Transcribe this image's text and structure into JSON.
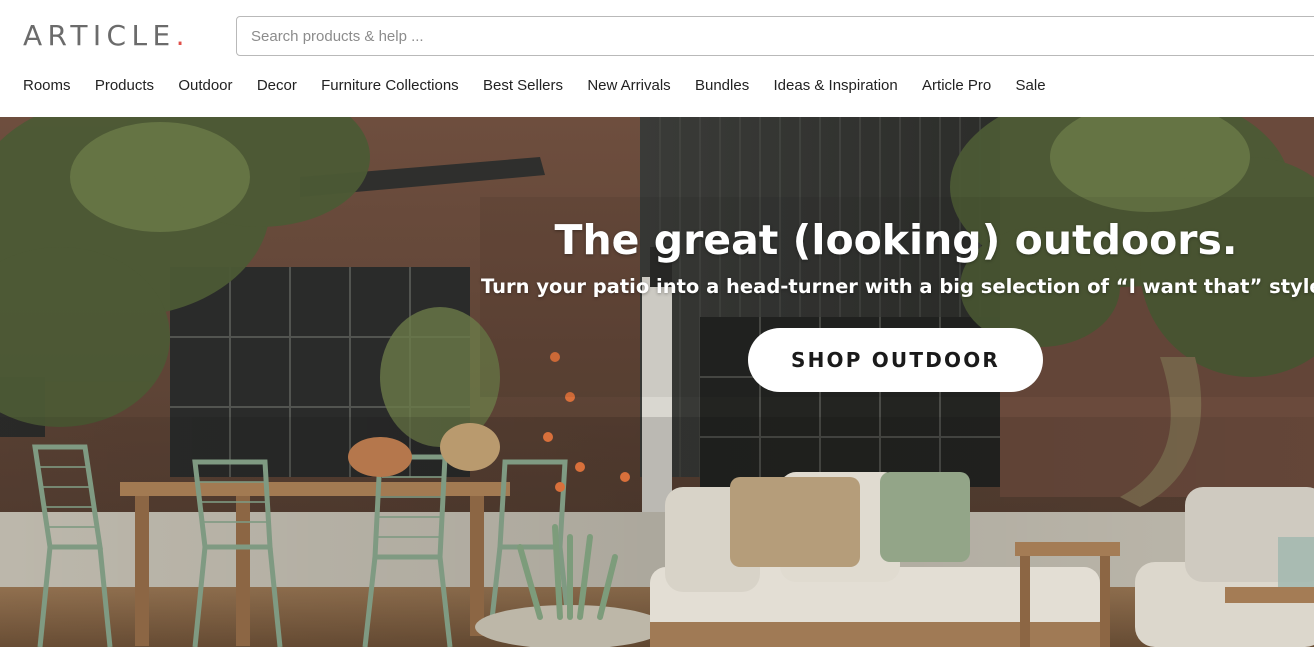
{
  "header": {
    "logo_text": "ARTICLE",
    "logo_dot": ".",
    "search": {
      "placeholder": "Search products & help ...",
      "value": ""
    }
  },
  "nav": {
    "items": [
      "Rooms",
      "Products",
      "Outdoor",
      "Decor",
      "Furniture Collections",
      "Best Sellers",
      "New Arrivals",
      "Bundles",
      "Ideas & Inspiration",
      "Article Pro",
      "Sale"
    ]
  },
  "hero": {
    "title": "The great (looking) outdoors.",
    "subtitle": "Turn your patio into a head-turner with a big selection of “I want that” styles.",
    "cta_label": "SHOP OUTDOOR"
  },
  "colors": {
    "logo_gray": "#6b6b6b",
    "logo_accent": "#e0504a",
    "nav_text": "#222222",
    "cta_bg": "#ffffff",
    "cta_text": "#1a1a1a"
  }
}
